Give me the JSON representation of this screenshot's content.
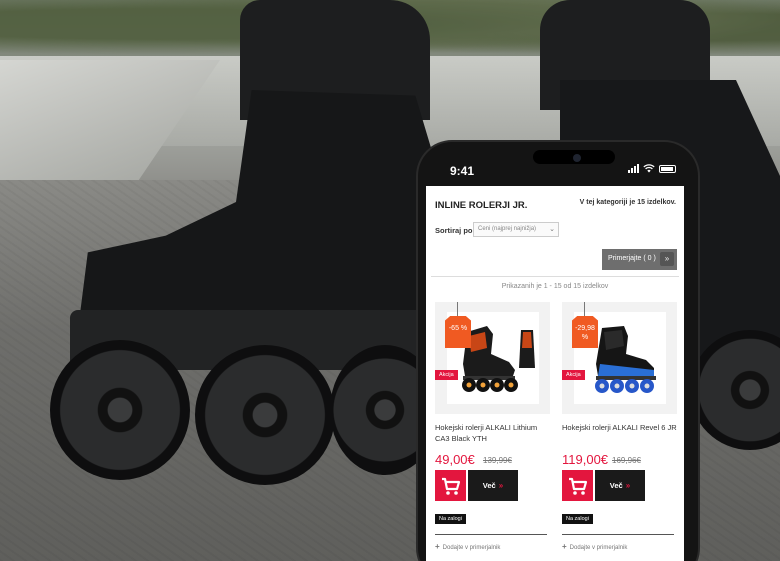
{
  "status_bar": {
    "time": "9:41"
  },
  "category": {
    "title": "INLINE ROLERJI JR.",
    "count_text": "V tej kategoriji je 15 izdelkov."
  },
  "sort": {
    "label": "Sortiraj po",
    "selected": "Ceni (najprej najnižja)"
  },
  "compare_button": {
    "label": "Primerjajte ( 0 )",
    "arrow": "»"
  },
  "showing_text": "Prikazanih je 1 - 15 od 15 izdelkov",
  "products": [
    {
      "discount": "-65 %",
      "badge": "Akcija",
      "name": "Hokejski rolerji ALKALI Lithium CA3 Black YTH",
      "price": "49,00€",
      "old_price": "139,99€",
      "more_label": "Več",
      "more_arrow": "»",
      "stock": "Na zalogi",
      "compare_label": "Dodajte v primerjalnik",
      "compare_icon": "+"
    },
    {
      "discount": "-29,98 %",
      "badge": "Akcija",
      "name": "Hokejski rolerji ALKALI Revel 6 JR",
      "price": "119,00€",
      "old_price": "169,96€",
      "more_label": "Več",
      "more_arrow": "»",
      "stock": "Na zalogi",
      "compare_label": "Dodajte v primerjalnik",
      "compare_icon": "+"
    }
  ],
  "colors": {
    "accent": "#e3163e",
    "discount": "#f05a22",
    "button_dark": "#1a1a1a",
    "compare_button": "#6e6e6e"
  },
  "icons": {
    "cart": "cart-icon",
    "wifi": "wifi-icon",
    "signal": "signal-icon",
    "battery": "battery-icon",
    "select_arrow": "chevron-down-icon"
  }
}
